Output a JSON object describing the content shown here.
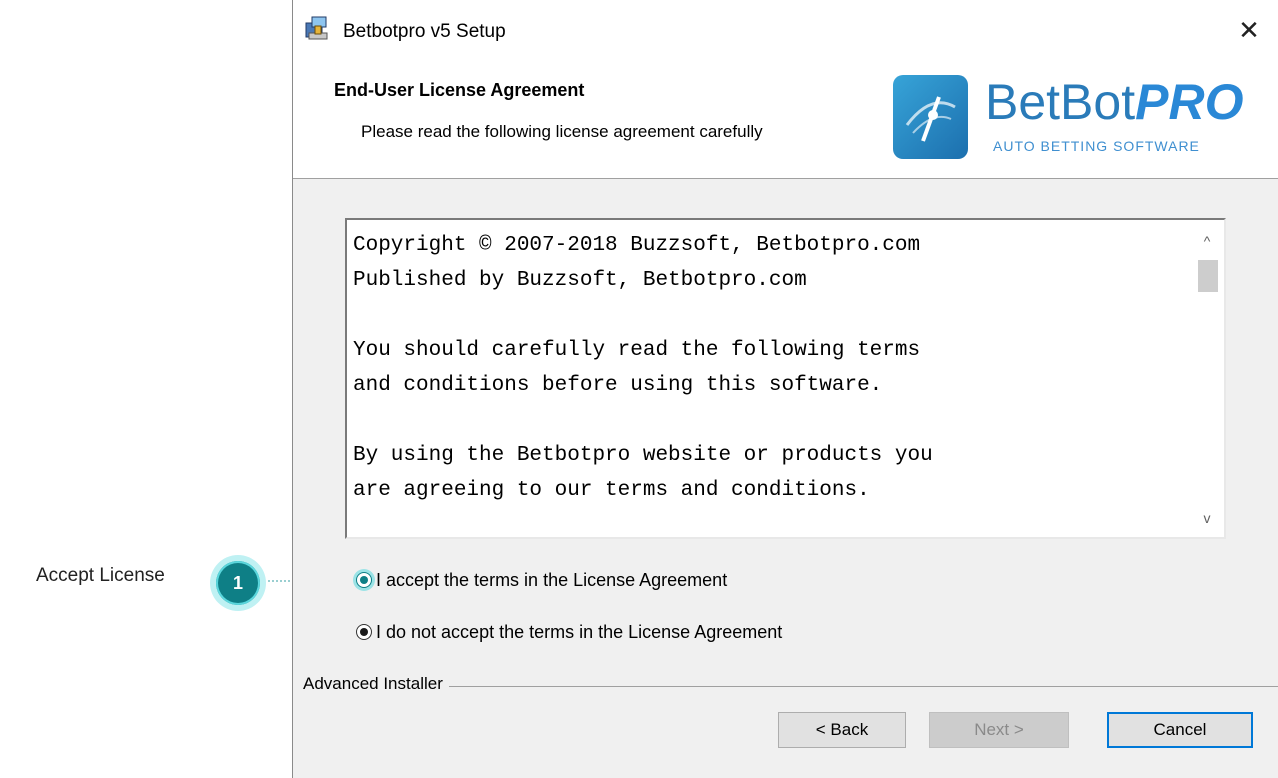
{
  "callout": {
    "label": "Accept License",
    "number": "1",
    "accent_color": "#0e7f86"
  },
  "window": {
    "title": "Betbotpro v5 Setup",
    "app_icon": "installer-icon",
    "close_glyph": "✕"
  },
  "header": {
    "title": "End-User License Agreement",
    "subtitle": "Please read the following license agreement carefully",
    "logo": {
      "name_main": "BetBot",
      "name_accent": "PRO",
      "tagline": "AUTO BETTING SOFTWARE"
    }
  },
  "license": {
    "text": "Copyright © 2007-2018 Buzzsoft, Betbotpro.com\nPublished by Buzzsoft, Betbotpro.com\n\nYou should carefully read the following terms\nand conditions before using this software.\n\nBy using the Betbotpro website or products you\nare agreeing to our terms and conditions.",
    "scroll_up_glyph": "^",
    "scroll_down_glyph": "v"
  },
  "options": {
    "accept_label": "I accept the terms in the License Agreement",
    "decline_label": "I do not accept the terms in the License Agreement",
    "selected": "decline"
  },
  "footer": {
    "group_label": "Advanced Installer",
    "back_label": "< Back",
    "next_label": "Next >",
    "cancel_label": "Cancel"
  }
}
